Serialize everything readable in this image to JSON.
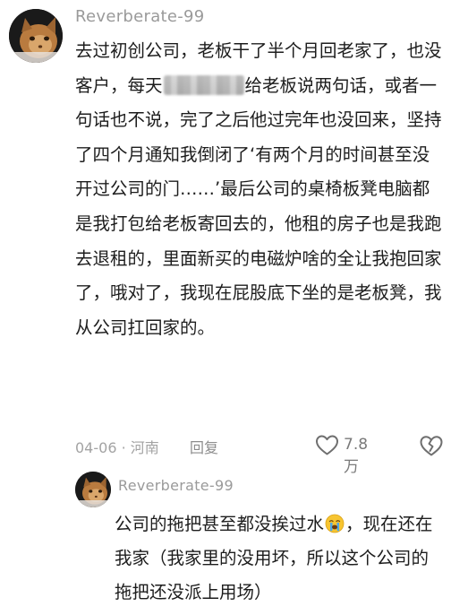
{
  "main_comment": {
    "username": "Reverberate-99",
    "body_part1": "去过初创公司，老板干了半个月回老家了，也没客户，每天",
    "body_part2": "给老板说两句话，或者一句话也不说，完了之后他过完年也没回来，坚持了四个月通知我倒闭了‘有两个月的时间甚至没开过公司的门……’最后公司的桌椅板凳电脑都是我打包给老板寄回去的，他租的房子也是我跑去退租的，里面新买的电磁炉啥的全让我抱回家了，哦对了，我现在屁股底下坐的是老板凳，我从公司扛回家的。",
    "date": "04-06",
    "location": "河南",
    "date_location": "04-06 · 河南",
    "reply_label": "回复",
    "like_count": "7.8万"
  },
  "reply_comment": {
    "username": "Reverberate-99",
    "body_part1": "公司的拖把甚至都没挨过水",
    "emoji": "crying-face",
    "body_part2": "，现在还在我家（我家里的没用坏，所以这个公司的拖把还没派上用场）"
  },
  "colors": {
    "username": "#9a9a9a",
    "text": "#1d1d1d",
    "meta": "#a3a3a3",
    "icon": "#6f6f6f"
  }
}
